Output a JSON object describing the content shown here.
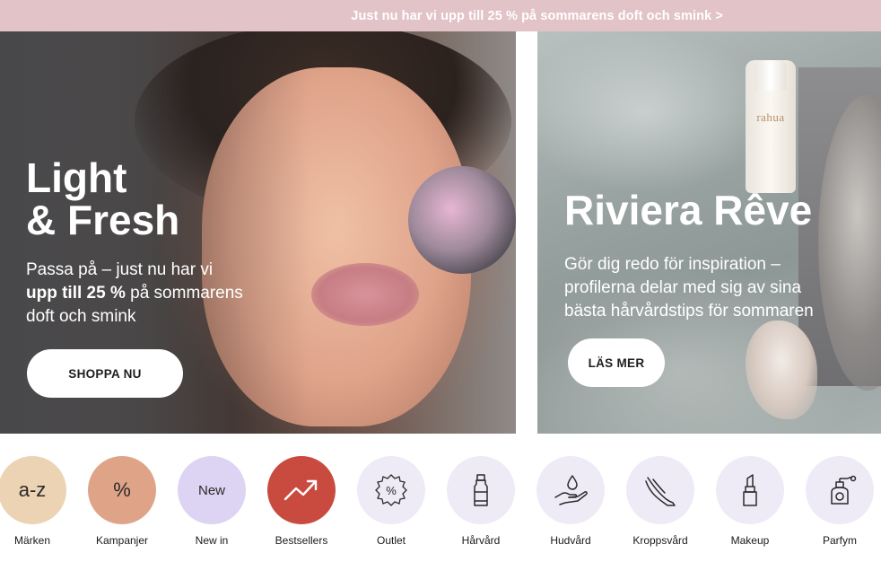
{
  "promo": {
    "text": "Just nu har vi upp till 25 % på sommarens doft och smink >"
  },
  "hero_left": {
    "title_line1": "Light",
    "title_line2": "& Fresh",
    "text_line1": "Passa på – just nu har vi",
    "text_line2_bold": "upp till 25 %",
    "text_line2_rest": " på sommarens",
    "text_line3": "doft och smink",
    "cta_label": "SHOPPA NU"
  },
  "hero_right": {
    "title": "Riviera Rêve",
    "text_line1": "Gör dig redo för inspiration –",
    "text_line2": "profilerna delar med sig av sina",
    "text_line3": "bästa hårvårdstips för sommaren",
    "cta_label": "LÄS MER",
    "bottle_label": "rahua"
  },
  "categories": [
    {
      "label": "Märken",
      "badge": "a-z",
      "color": "#ebd3b3",
      "icon": "a-z-text"
    },
    {
      "label": "Kampanjer",
      "badge": "%",
      "color": "#dfa488",
      "icon": "percent-text"
    },
    {
      "label": "New in",
      "badge": "New",
      "color": "#ddd3f3",
      "icon": "new-text"
    },
    {
      "label": "Bestsellers",
      "badge": "",
      "color": "#c94b40",
      "icon": "trending-up-icon"
    },
    {
      "label": "Outlet",
      "badge": "",
      "color": "#eeebf7",
      "icon": "outlet-percent-badge-icon"
    },
    {
      "label": "Hårvård",
      "badge": "",
      "color": "#eeebf7",
      "icon": "bottle-icon"
    },
    {
      "label": "Hudvård",
      "badge": "",
      "color": "#eeebf7",
      "icon": "hand-drop-icon"
    },
    {
      "label": "Kroppsvård",
      "badge": "",
      "color": "#eeebf7",
      "icon": "leg-icon"
    },
    {
      "label": "Makeup",
      "badge": "",
      "color": "#eeebf7",
      "icon": "lipstick-icon"
    },
    {
      "label": "Parfym",
      "badge": "",
      "color": "#eeebf7",
      "icon": "perfume-bottle-icon"
    }
  ]
}
